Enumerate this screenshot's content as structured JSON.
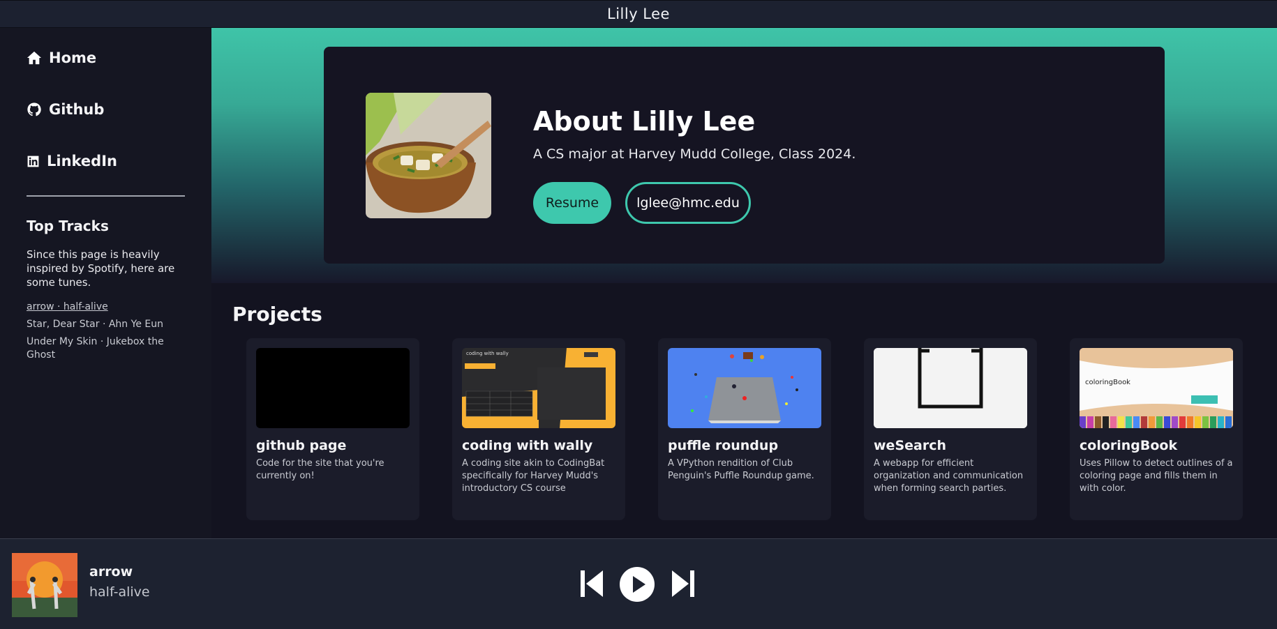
{
  "window": {
    "title": "Lilly Lee"
  },
  "sidebar": {
    "nav": [
      {
        "label": "Home",
        "icon": "home-icon"
      },
      {
        "label": "Github",
        "icon": "github-icon"
      },
      {
        "label": "LinkedIn",
        "icon": "linkedin-icon"
      }
    ],
    "top_tracks_title": "Top Tracks",
    "top_tracks_description": "Since this page is heavily inspired by Spotify, here are some tunes.",
    "tracks": [
      "arrow · half-alive",
      "Star, Dear Star · Ahn Ye Eun",
      "Under My Skin · Jukebox the Ghost"
    ]
  },
  "hero": {
    "title": "About Lilly Lee",
    "subtitle": "A CS major at Harvey Mudd College, Class 2024.",
    "resume_label": "Resume",
    "email_label": "lglee@hmc.edu",
    "accent_color": "#3ec8ad"
  },
  "projects": {
    "title": "Projects",
    "items": [
      {
        "name": "github page",
        "description": "Code for the site that you're currently on!"
      },
      {
        "name": "coding with wally",
        "description": "A coding site akin to CodingBat specifically for Harvey Mudd's introductory CS course",
        "thumb_title": "coding with wally"
      },
      {
        "name": "puffle roundup",
        "description": "A VPython rendition of Club Penguin's Puffle Roundup game."
      },
      {
        "name": "weSearch",
        "description": "A webapp for efficient organization and communication when forming search parties."
      },
      {
        "name": "coloringBook",
        "description": "Uses Pillow to detect outlines of a coloring page and fills them in with color.",
        "thumb_title": "coloringBook"
      }
    ]
  },
  "player": {
    "song": "arrow",
    "artist": "half-alive",
    "controls": [
      "skip-back-icon",
      "play-icon",
      "skip-forward-icon"
    ]
  }
}
